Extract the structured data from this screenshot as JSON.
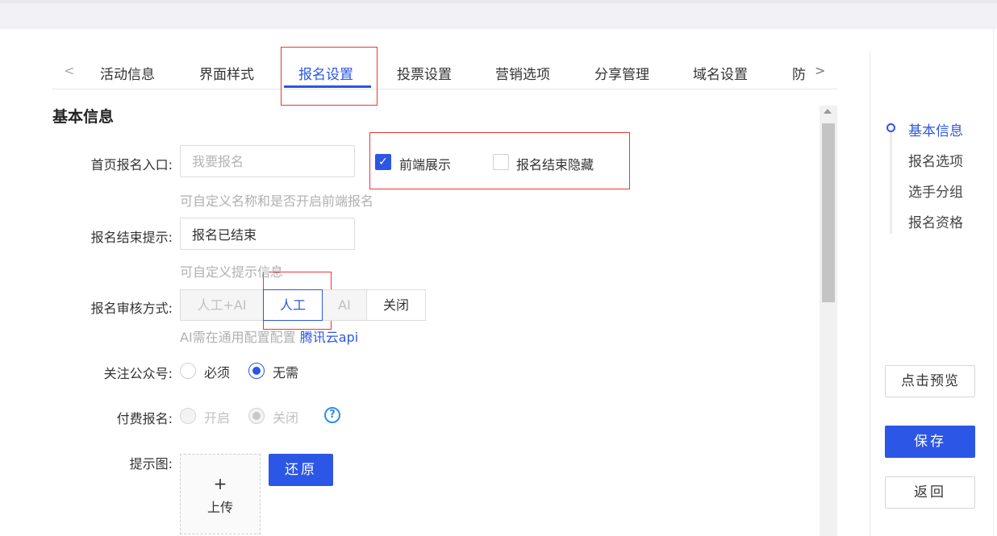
{
  "tabs": {
    "items": [
      {
        "label": "活动信息"
      },
      {
        "label": "界面样式"
      },
      {
        "label": "报名设置"
      },
      {
        "label": "投票设置"
      },
      {
        "label": "营销选项"
      },
      {
        "label": "分享管理"
      },
      {
        "label": "域名设置"
      },
      {
        "label": "防"
      }
    ],
    "active_index": 2,
    "prev_glyph": "<",
    "next_glyph": ">"
  },
  "section": {
    "title": "基本信息"
  },
  "form": {
    "entry": {
      "label": "首页报名入口:",
      "placeholder": "我要报名",
      "frontend_show": {
        "label": "前端展示",
        "checked": true
      },
      "hide_after_end": {
        "label": "报名结束隐藏",
        "checked": false
      },
      "hint": "可自定义名称和是否开启前端报名"
    },
    "end_tip": {
      "label": "报名结束提示:",
      "value": "报名已结束",
      "hint": "可自定义提示信息"
    },
    "review": {
      "label": "报名审核方式:",
      "options": [
        "人工+AI",
        "人工",
        "AI",
        "关闭"
      ],
      "selected": "人工",
      "hint_prefix": "AI需在通用配置配置",
      "hint_link": "腾讯云api"
    },
    "follow": {
      "label": "关注公众号:",
      "options": [
        "必须",
        "无需"
      ],
      "selected": "无需"
    },
    "paid": {
      "label": "付费报名:",
      "options": [
        "开启",
        "关闭"
      ],
      "selected": "关闭",
      "help_glyph": "?"
    },
    "image": {
      "label": "提示图:",
      "upload_plus": "+",
      "upload_text": "上传",
      "restore_label": "还原"
    }
  },
  "sidebar": {
    "anchors": [
      "基本信息",
      "报名选项",
      "选手分组",
      "报名资格"
    ],
    "active_index": 0,
    "preview_label": "点击预览",
    "save_label": "保存",
    "back_label": "返回"
  },
  "colors": {
    "primary": "#2c56e6",
    "highlight_box": "#e33333"
  }
}
